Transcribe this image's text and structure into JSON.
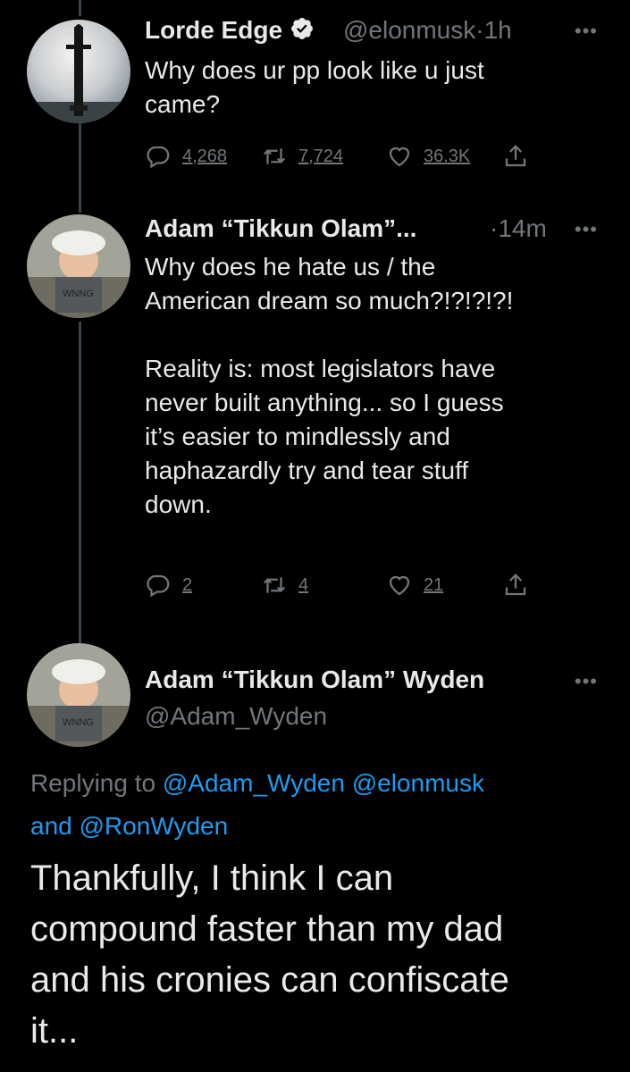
{
  "tweets": [
    {
      "name": "Lorde Edge",
      "verified": true,
      "handle": "@elonmusk",
      "separator": "·",
      "time": "1h",
      "text": "Why does ur pp look like u just\ncame?",
      "replies": "4,268",
      "retweets": "7,724",
      "likes": "36.3K"
    },
    {
      "name": "Adam “Tikkun Olam”...",
      "separator": "·",
      "time": "14m",
      "text": "Why does he hate us / the\nAmerican dream so much?!?!?!?!\n\nReality is: most legislators have\nnever built anything... so I guess\nit’s easier to mindlessly and\nhaphazardly try and tear stuff\ndown.",
      "replies": "2",
      "retweets": "4",
      "likes": "21"
    }
  ],
  "main": {
    "name": "Adam “Tikkun Olam” Wyden",
    "handle": "@Adam_Wyden",
    "replying_prefix": "Replying to ",
    "reply_handles": [
      "@Adam_Wyden",
      "@elonmusk"
    ],
    "reply_and": "and",
    "reply_last": "@RonWyden",
    "text": "Thankfully, I think I can\ncompound faster than my dad\nand his cronies can confiscate\nit..."
  },
  "icons": {
    "more": "more-horizontal-icon",
    "reply": "reply-icon",
    "retweet": "retweet-icon",
    "like": "heart-icon",
    "share": "share-icon",
    "verified": "verified-badge-icon"
  },
  "colors": {
    "background": "#000000",
    "link": "#1d9bf0",
    "muted": "#71767b",
    "text": "#e7e9ea"
  }
}
